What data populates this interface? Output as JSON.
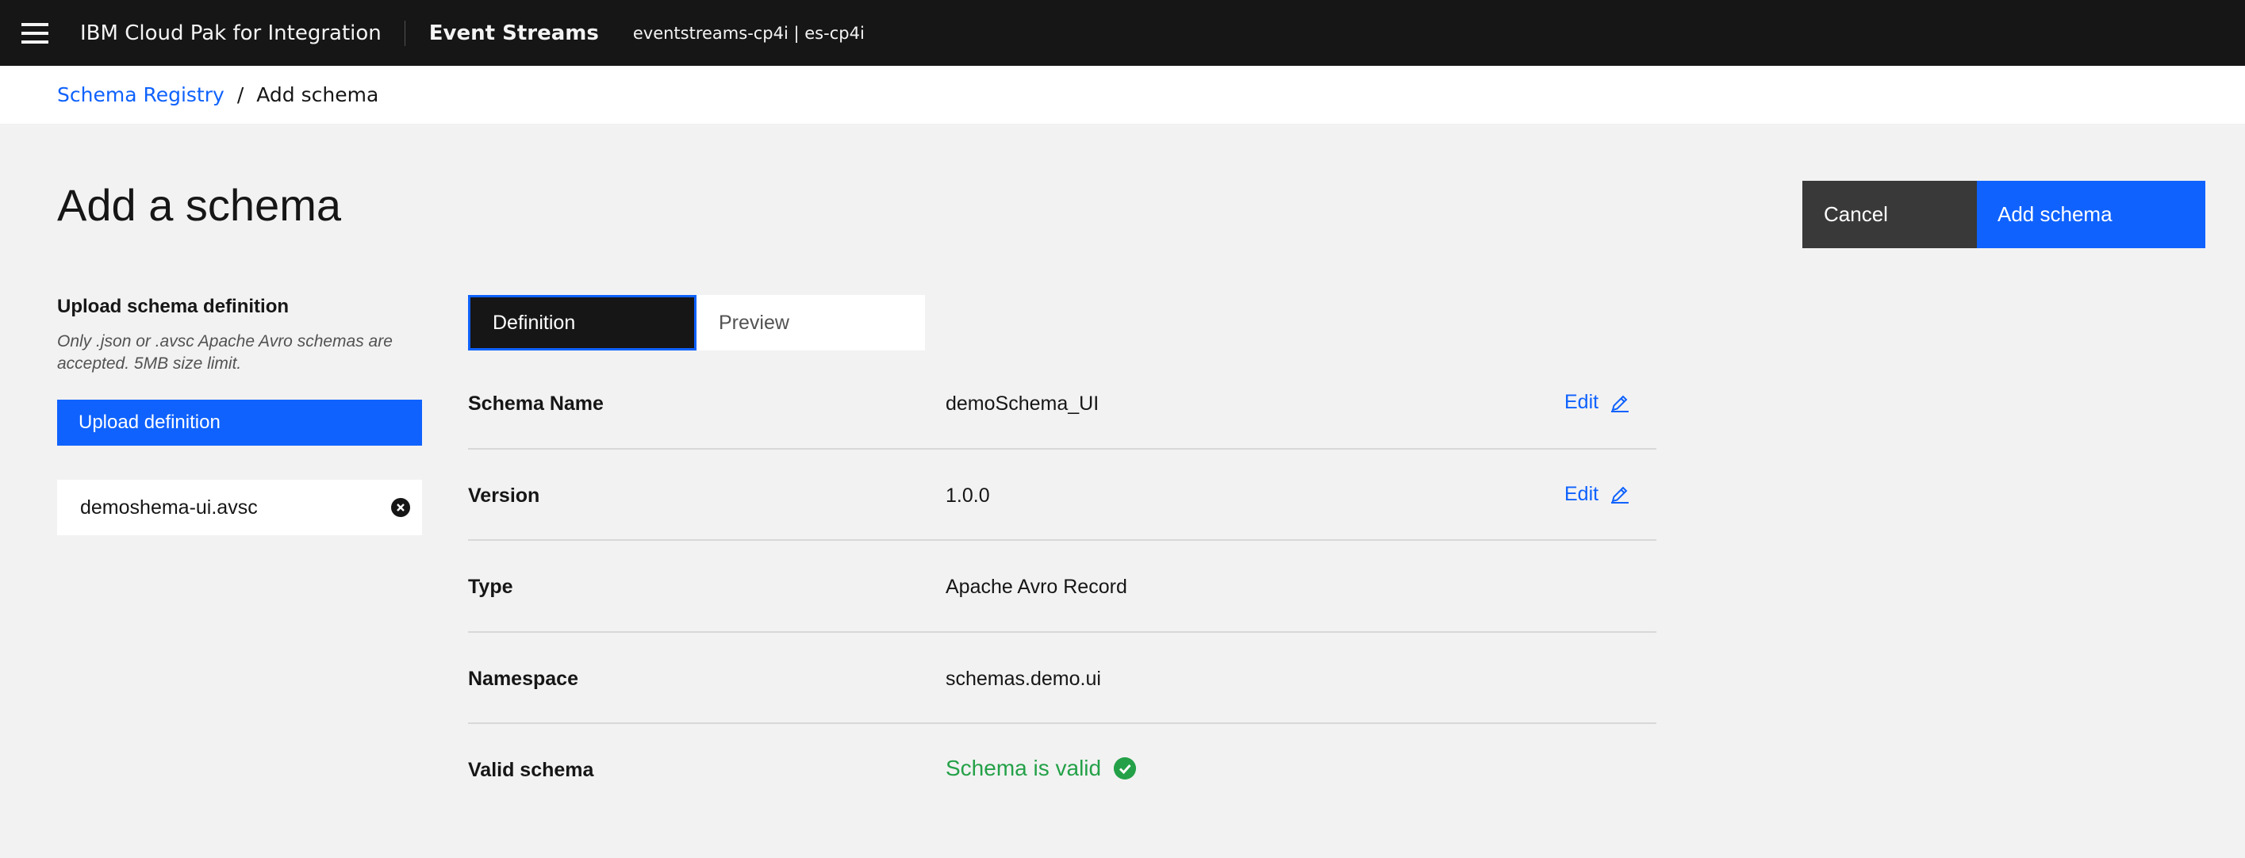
{
  "header": {
    "product": "IBM Cloud Pak for Integration",
    "app": "Event Streams",
    "instance": "eventstreams-cp4i | es-cp4i"
  },
  "breadcrumb": {
    "parent": "Schema Registry",
    "separator": "/",
    "current": "Add schema"
  },
  "page": {
    "title": "Add a schema"
  },
  "actions": {
    "cancel": "Cancel",
    "add": "Add schema"
  },
  "upload": {
    "heading": "Upload schema definition",
    "help": "Only .json or .avsc Apache Avro schemas are accepted. 5MB size limit.",
    "button": "Upload definition",
    "file_name": "demoshema-ui.avsc"
  },
  "tabs": [
    {
      "label": "Definition",
      "selected": true
    },
    {
      "label": "Preview",
      "selected": false
    }
  ],
  "properties": [
    {
      "label": "Schema Name",
      "value": "demoSchema_UI",
      "edit": "Edit"
    },
    {
      "label": "Version",
      "value": "1.0.0",
      "edit": "Edit"
    },
    {
      "label": "Type",
      "value": "Apache Avro Record"
    },
    {
      "label": "Namespace",
      "value": "schemas.demo.ui"
    },
    {
      "label": "Valid schema",
      "value": "Schema is valid",
      "status_color": "#24a148"
    }
  ],
  "colors": {
    "accent": "#0f62fe",
    "header_bg": "#161616",
    "success": "#24a148"
  }
}
